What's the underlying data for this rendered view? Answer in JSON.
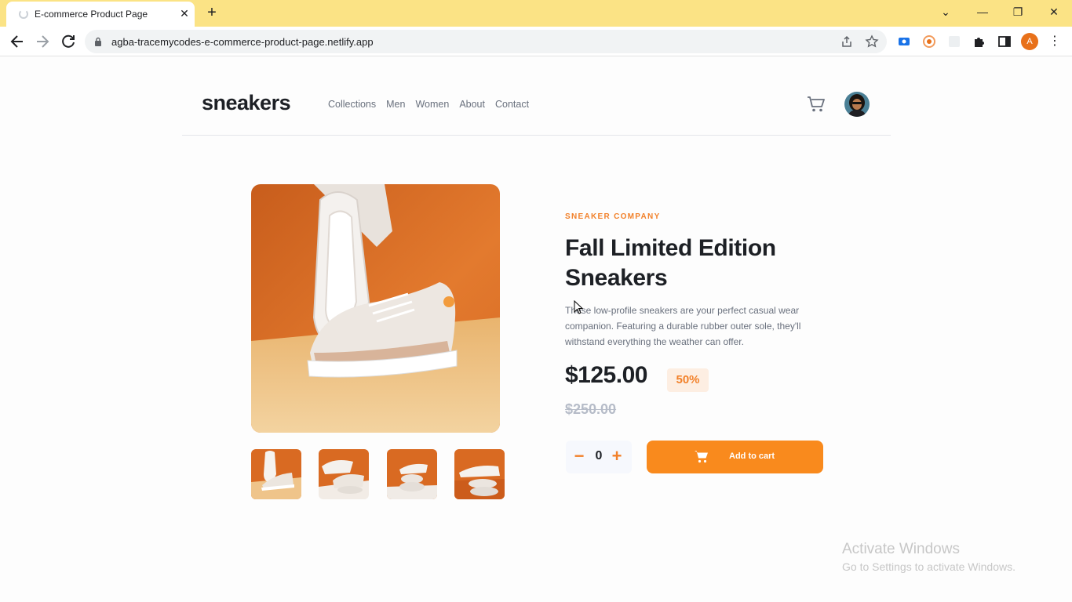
{
  "browser": {
    "tab_title": "E-commerce Product Page",
    "tab_close": "✕",
    "new_tab": "+",
    "url": "agba-tracemycodes-e-commerce-product-page.netlify.app",
    "profile_initial": "A",
    "window_buttons": {
      "dropdown": "⌄",
      "minimize": "—",
      "restore": "❐",
      "close": "✕"
    },
    "menu_glyph": "⋮"
  },
  "site": {
    "logo": "sneakers",
    "nav": [
      "Collections",
      "Men",
      "Women",
      "About",
      "Contact"
    ]
  },
  "product": {
    "company": "SNEAKER COMPANY",
    "title": "Fall Limited Edition Sneakers",
    "description": "These low-profile sneakers are your perfect casual wear companion. Featuring a durable rubber outer sole, they'll withstand everything the weather can offer.",
    "price": "$125.00",
    "discount": "50%",
    "original_price": "$250.00",
    "quantity": "0",
    "minus_glyph": "−",
    "plus_glyph": "+",
    "add_to_cart": "Add to cart"
  },
  "watermark": {
    "title": "Activate Windows",
    "subtitle": "Go to Settings to activate Windows."
  },
  "colors": {
    "accent": "#f98a1d",
    "tabbar": "#fbe385",
    "heading": "#1d2025",
    "muted": "#69707d"
  },
  "icons": [
    "favicon-icon",
    "back-icon",
    "forward-icon",
    "reload-icon",
    "lock-icon",
    "share-icon",
    "star-icon",
    "extension-icon",
    "puzzle-icon",
    "sidebar-icon",
    "cart-icon",
    "avatar"
  ]
}
